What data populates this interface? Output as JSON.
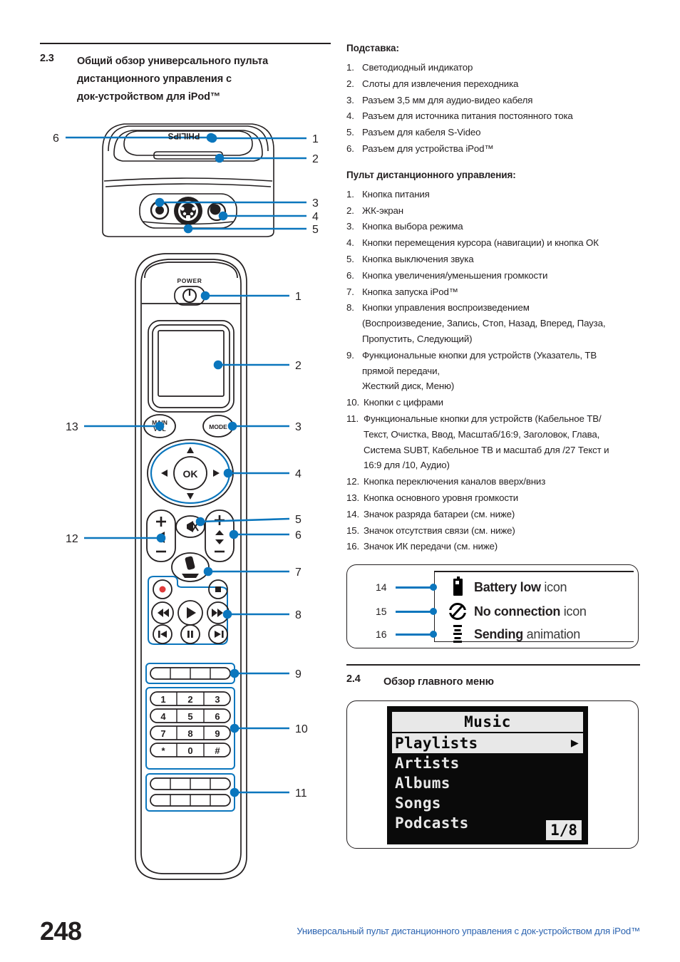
{
  "accent_blue": "#0b76bd",
  "footer_blue": "#2b63b0",
  "ink": "#231f20",
  "section_23": {
    "number": "2.3",
    "title_line1": "Общий обзор универсального пульта",
    "title_line2": "дистанционного управления с",
    "title_line3": "док-устройством для iPod™"
  },
  "dock": {
    "heading": "Подставка:",
    "items": [
      {
        "n": "1.",
        "text": "Светодиодный индикатор"
      },
      {
        "n": "2.",
        "text": "Слоты для извлечения переходника"
      },
      {
        "n": "3.",
        "text": "Разъем 3,5 мм для аудио-видео кабеля"
      },
      {
        "n": "4.",
        "text": "Разъем для источника питания постоянного тока"
      },
      {
        "n": "5.",
        "text": "Разъем для кабеля S-Video"
      },
      {
        "n": "6.",
        "text": "Разъем для устройства iPod™"
      }
    ],
    "callouts": [
      "1",
      "2",
      "3",
      "4",
      "5",
      "6"
    ],
    "brand": "PHILIPS"
  },
  "remote_list": {
    "heading": "Пульт дистанционного управления:",
    "items": [
      {
        "n": "1.",
        "text": "Кнопка питания",
        "cont": []
      },
      {
        "n": "2.",
        "text": "ЖК-экран",
        "cont": []
      },
      {
        "n": "3.",
        "text": "Кнопка выбора режима",
        "cont": []
      },
      {
        "n": "4.",
        "text": "Кнопки перемещения курсора (навигации) и кнопка ОК",
        "cont": []
      },
      {
        "n": "5.",
        "text": "Кнопка выключения звука",
        "cont": []
      },
      {
        "n": "6.",
        "text": "Кнопка увеличения/уменьшения громкости",
        "cont": []
      },
      {
        "n": "7.",
        "text": "Кнопка запуска iPod™",
        "cont": []
      },
      {
        "n": "8.",
        "text": "Кнопки управления воспроизведением",
        "cont": [
          "(Воспроизведение, Запись, Стоп, Назад, Вперед, Пауза,",
          "Пропустить, Следующий)"
        ]
      },
      {
        "n": "9.",
        "text": "Функциональные кнопки для устройств (Указатель, ТВ",
        "cont": [
          "прямой передачи,",
          "Жесткий диск, Меню)"
        ]
      },
      {
        "n": "10.",
        "text": "Кнопки с цифрами",
        "cont": []
      },
      {
        "n": "11.",
        "text": "Функциональные кнопки для устройств (Кабельное ТВ/",
        "cont": [
          "Текст, Очистка, Ввод, Масштаб/16:9, Заголовок, Глава,",
          "Система SUBT, Кабельное ТВ и масштаб для /27 Текст и",
          "16:9 для /10, Аудио)"
        ]
      },
      {
        "n": "12.",
        "text": "Кнопка переключения каналов вверх/вниз",
        "cont": []
      },
      {
        "n": "13.",
        "text": "Кнопка основного уровня громкости",
        "cont": []
      },
      {
        "n": "14.",
        "text": "Значок разряда батареи (см. ниже)",
        "cont": []
      },
      {
        "n": "15.",
        "text": "Значок отсутствия связи (см. ниже)",
        "cont": []
      },
      {
        "n": "16.",
        "text": "Значок ИК передачи (см. ниже)",
        "cont": []
      }
    ],
    "callouts": [
      "1",
      "2",
      "3",
      "4",
      "5",
      "6",
      "7",
      "8",
      "9",
      "10",
      "11",
      "12",
      "13"
    ],
    "power_label": "POWER",
    "main_vol_label_1": "MAIN",
    "main_vol_label_2": "VOL",
    "mode_label": "MODE",
    "ok_label": "OK",
    "keypad": [
      "1",
      "2",
      "3",
      "4",
      "5",
      "6",
      "7",
      "8",
      "9",
      "*",
      "0",
      "#"
    ]
  },
  "icon_legend": [
    {
      "num": "14",
      "icon": "battery-low-icon",
      "bold": "Battery low",
      "rest": " icon"
    },
    {
      "num": "15",
      "icon": "no-connection-icon",
      "bold": "No connection",
      "rest": " icon"
    },
    {
      "num": "16",
      "icon": "sending-animation-icon",
      "bold": "Sending",
      "rest": " animation"
    }
  ],
  "section_24": {
    "number": "2.4",
    "title": "Обзор главного меню"
  },
  "lcd_menu": {
    "title": "Music",
    "rows": [
      {
        "label": "Playlists",
        "selected": true,
        "arrow": "▶"
      },
      {
        "label": "Artists",
        "selected": false,
        "arrow": ""
      },
      {
        "label": "Albums",
        "selected": false,
        "arrow": ""
      },
      {
        "label": "Songs",
        "selected": false,
        "arrow": ""
      },
      {
        "label": "Podcasts",
        "selected": false,
        "arrow": ""
      }
    ],
    "badge": "1/8"
  },
  "footer": {
    "page_number": "248",
    "text": "Универсальный пульт дистанционного управления с док-устройством для iPod™"
  }
}
